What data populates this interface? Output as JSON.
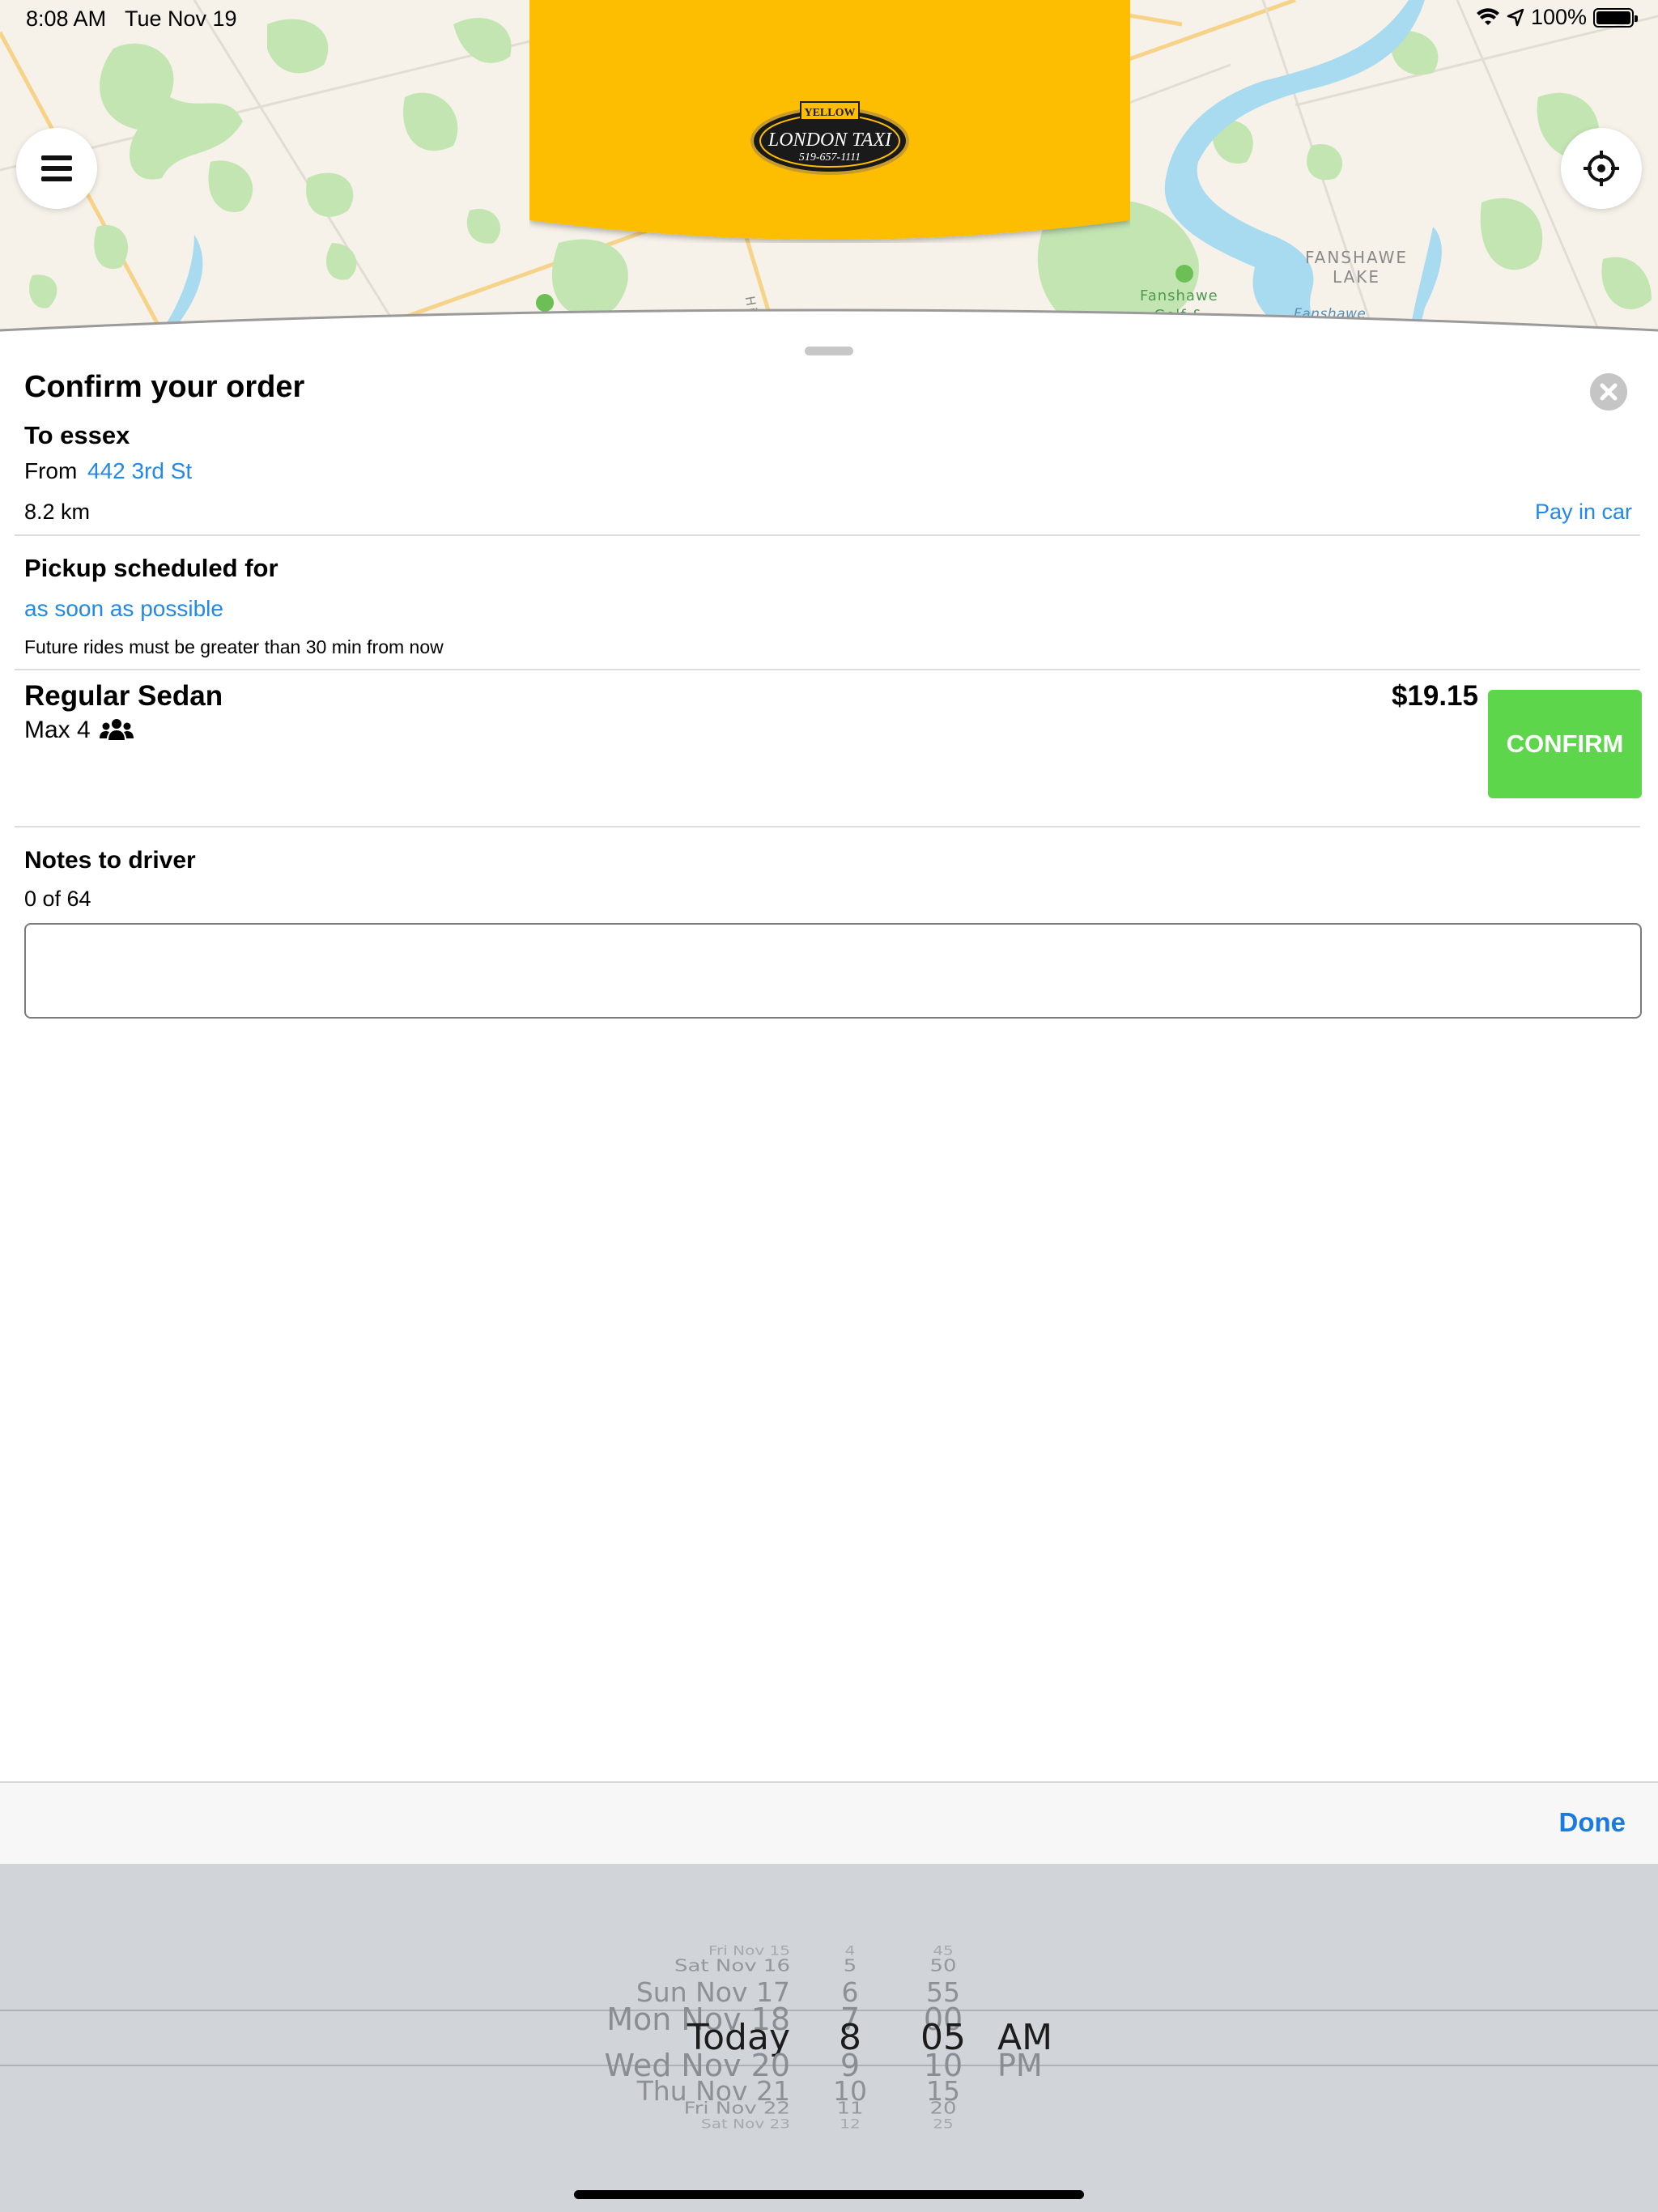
{
  "status_bar": {
    "time": "8:08 AM",
    "date": "Tue Nov 19",
    "battery": "100%",
    "icons": [
      "wifi-icon",
      "location-arrow-icon",
      "battery-icon"
    ]
  },
  "map": {
    "labels": {
      "lake": "FANSHAWE\nLAKE",
      "golf": "Fanshawe\nGolf &",
      "water": "Fanshawe",
      "road": "Hig"
    },
    "colors": {
      "land": "#f6f2ea",
      "park": "#c3e5b2",
      "water": "#a9dbf0",
      "road": "#f7d389"
    }
  },
  "banner": {
    "color": "#fdbd01",
    "logo": {
      "top": "YELLOW",
      "name": "LONDON TAXI",
      "phone": "519-657-1111"
    }
  },
  "order": {
    "title": "Confirm your order",
    "to_line": "To essex",
    "from_label": "From",
    "from_value": "442 3rd St",
    "distance": "8.2 km",
    "payment_link": "Pay in car"
  },
  "pickup": {
    "title": "Pickup scheduled for",
    "value": "as soon as possible",
    "note": "Future rides must be greater than 30 min from now"
  },
  "vehicle": {
    "name": "Regular Sedan",
    "capacity": "Max 4",
    "price": "$19.15",
    "confirm_label": "CONFIRM",
    "confirm_color": "#5ed64b"
  },
  "notes": {
    "title": "Notes to driver",
    "counter": "0 of 64",
    "value": ""
  },
  "picker": {
    "done_label": "Done",
    "dates": [
      "Fri Nov 15",
      "Sat Nov 16",
      "Sun Nov 17",
      "Mon Nov 18",
      "Today",
      "Wed Nov 20",
      "Thu Nov 21",
      "Fri Nov 22",
      "Sat Nov 23"
    ],
    "hours": [
      "4",
      "5",
      "6",
      "7",
      "8",
      "9",
      "10",
      "11",
      "12"
    ],
    "minutes": [
      "45",
      "50",
      "55",
      "00",
      "05",
      "10",
      "15",
      "20",
      "25"
    ],
    "periods": [
      "",
      "",
      "",
      "",
      "AM",
      "PM",
      "",
      "",
      ""
    ],
    "selected_index": 4
  },
  "accent_color": "#2189e8"
}
